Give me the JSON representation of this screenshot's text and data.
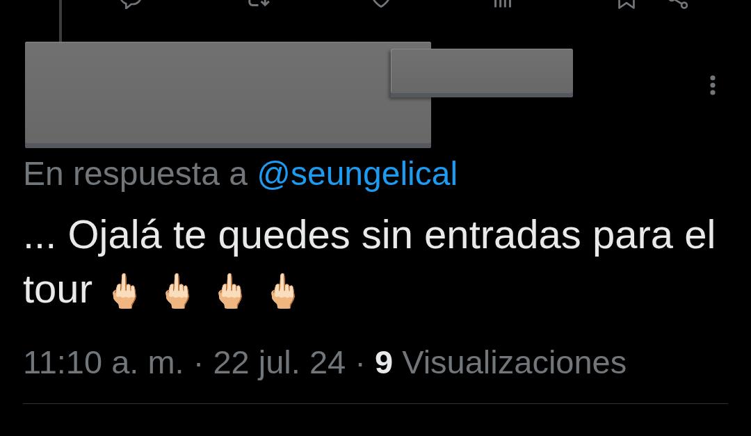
{
  "action_bar": {
    "liked": false,
    "bookmarked": false
  },
  "tweet": {
    "reply_to": {
      "prefix": "En respuesta a",
      "handle": "@seungelical"
    },
    "text": "... Ojalá te quedes sin entradas para el tour",
    "emojis": [
      "🖕🏻",
      "🖕🏻",
      "🖕🏻",
      "🖕🏻"
    ],
    "meta": "11:10 a. m. · 22 jul. 24 · **9** Visualizaciones"
  }
}
